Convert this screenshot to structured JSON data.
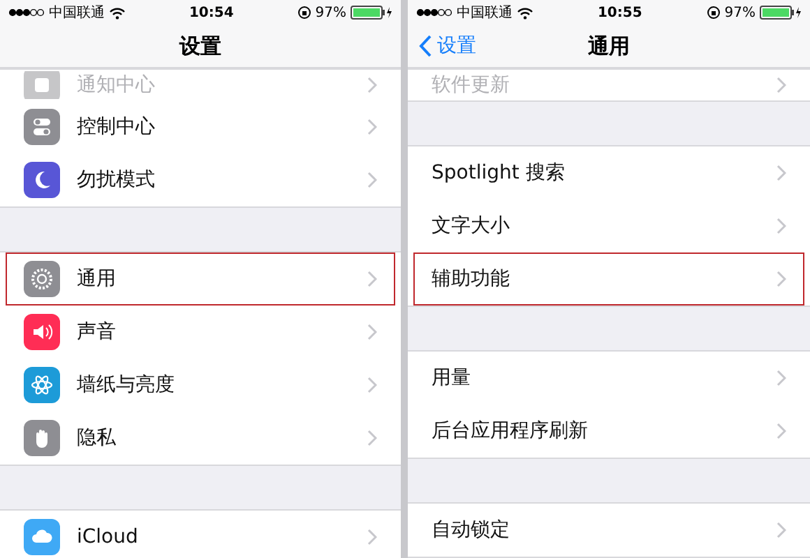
{
  "screens": [
    {
      "status_bar": {
        "carrier": "中国联通",
        "time": "10:54",
        "battery": "97%"
      },
      "nav": {
        "title": "设置"
      },
      "groups": [
        {
          "rows": [
            {
              "label": "通知中心",
              "kind": "notifications",
              "partial": true,
              "highlighted": false
            },
            {
              "label": "控制中心",
              "kind": "control",
              "partial": false,
              "highlighted": false
            },
            {
              "label": "勿扰模式",
              "kind": "moon",
              "partial": false,
              "highlighted": false
            }
          ]
        },
        {
          "rows": [
            {
              "label": "通用",
              "kind": "gear",
              "partial": false,
              "highlighted": true
            },
            {
              "label": "声音",
              "kind": "sound",
              "partial": false,
              "highlighted": false
            },
            {
              "label": "墙纸与亮度",
              "kind": "flower",
              "partial": false,
              "highlighted": false
            },
            {
              "label": "隐私",
              "kind": "hand",
              "partial": false,
              "highlighted": false
            }
          ]
        },
        {
          "rows": [
            {
              "label": "iCloud",
              "kind": "cloud",
              "partial": false,
              "highlighted": false
            }
          ]
        }
      ]
    },
    {
      "status_bar": {
        "carrier": "中国联通",
        "time": "10:55",
        "battery": "97%"
      },
      "nav": {
        "title": "通用",
        "back": "设置"
      },
      "groups": [
        {
          "rows": [
            {
              "label": "软件更新",
              "kind": "plain",
              "partial": true,
              "highlighted": false
            }
          ]
        },
        {
          "rows": [
            {
              "label": "Spotlight 搜索",
              "kind": "plain",
              "partial": false,
              "highlighted": false
            },
            {
              "label": "文字大小",
              "kind": "plain",
              "partial": false,
              "highlighted": false
            },
            {
              "label": "辅助功能",
              "kind": "plain",
              "partial": false,
              "highlighted": true
            }
          ]
        },
        {
          "rows": [
            {
              "label": "用量",
              "kind": "plain",
              "partial": false,
              "highlighted": false
            },
            {
              "label": "后台应用程序刷新",
              "kind": "plain",
              "partial": false,
              "highlighted": false
            }
          ]
        },
        {
          "rows": [
            {
              "label": "自动锁定",
              "kind": "plain",
              "partial": false,
              "highlighted": false
            }
          ]
        }
      ]
    }
  ]
}
